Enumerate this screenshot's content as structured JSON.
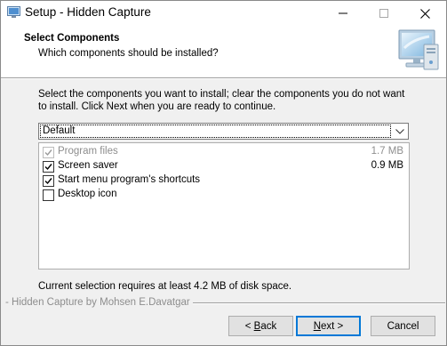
{
  "window": {
    "title": "Setup - Hidden Capture",
    "controls": {
      "minimize": "minimize",
      "maximize": "maximize",
      "close": "close"
    }
  },
  "header": {
    "title": "Select Components",
    "subtitle": "Which components should be installed?"
  },
  "instructions": "Select the components you want to install; clear the components you do not want to install. Click Next when you are ready to continue.",
  "type_select": {
    "value": "Default"
  },
  "components": [
    {
      "label": "Program files",
      "size": "1.7 MB",
      "checked": true,
      "disabled": true
    },
    {
      "label": "Screen saver",
      "size": "0.9 MB",
      "checked": true,
      "disabled": false
    },
    {
      "label": "Start menu program's shortcuts",
      "size": "",
      "checked": true,
      "disabled": false
    },
    {
      "label": "Desktop icon",
      "size": "",
      "checked": false,
      "disabled": false
    }
  ],
  "disk_space": "Current selection requires at least 4.2 MB of disk space.",
  "footer": {
    "brand": "- Hidden Capture by Mohsen E.Davatgar",
    "back_prefix": "< ",
    "back_accel": "B",
    "back_rest": "ack",
    "next_accel": "N",
    "next_rest": "ext >",
    "cancel": "Cancel"
  },
  "colors": {
    "accent": "#0078d7",
    "window_bg": "#f0f0f0",
    "disabled_text": "#8d8d8d"
  }
}
